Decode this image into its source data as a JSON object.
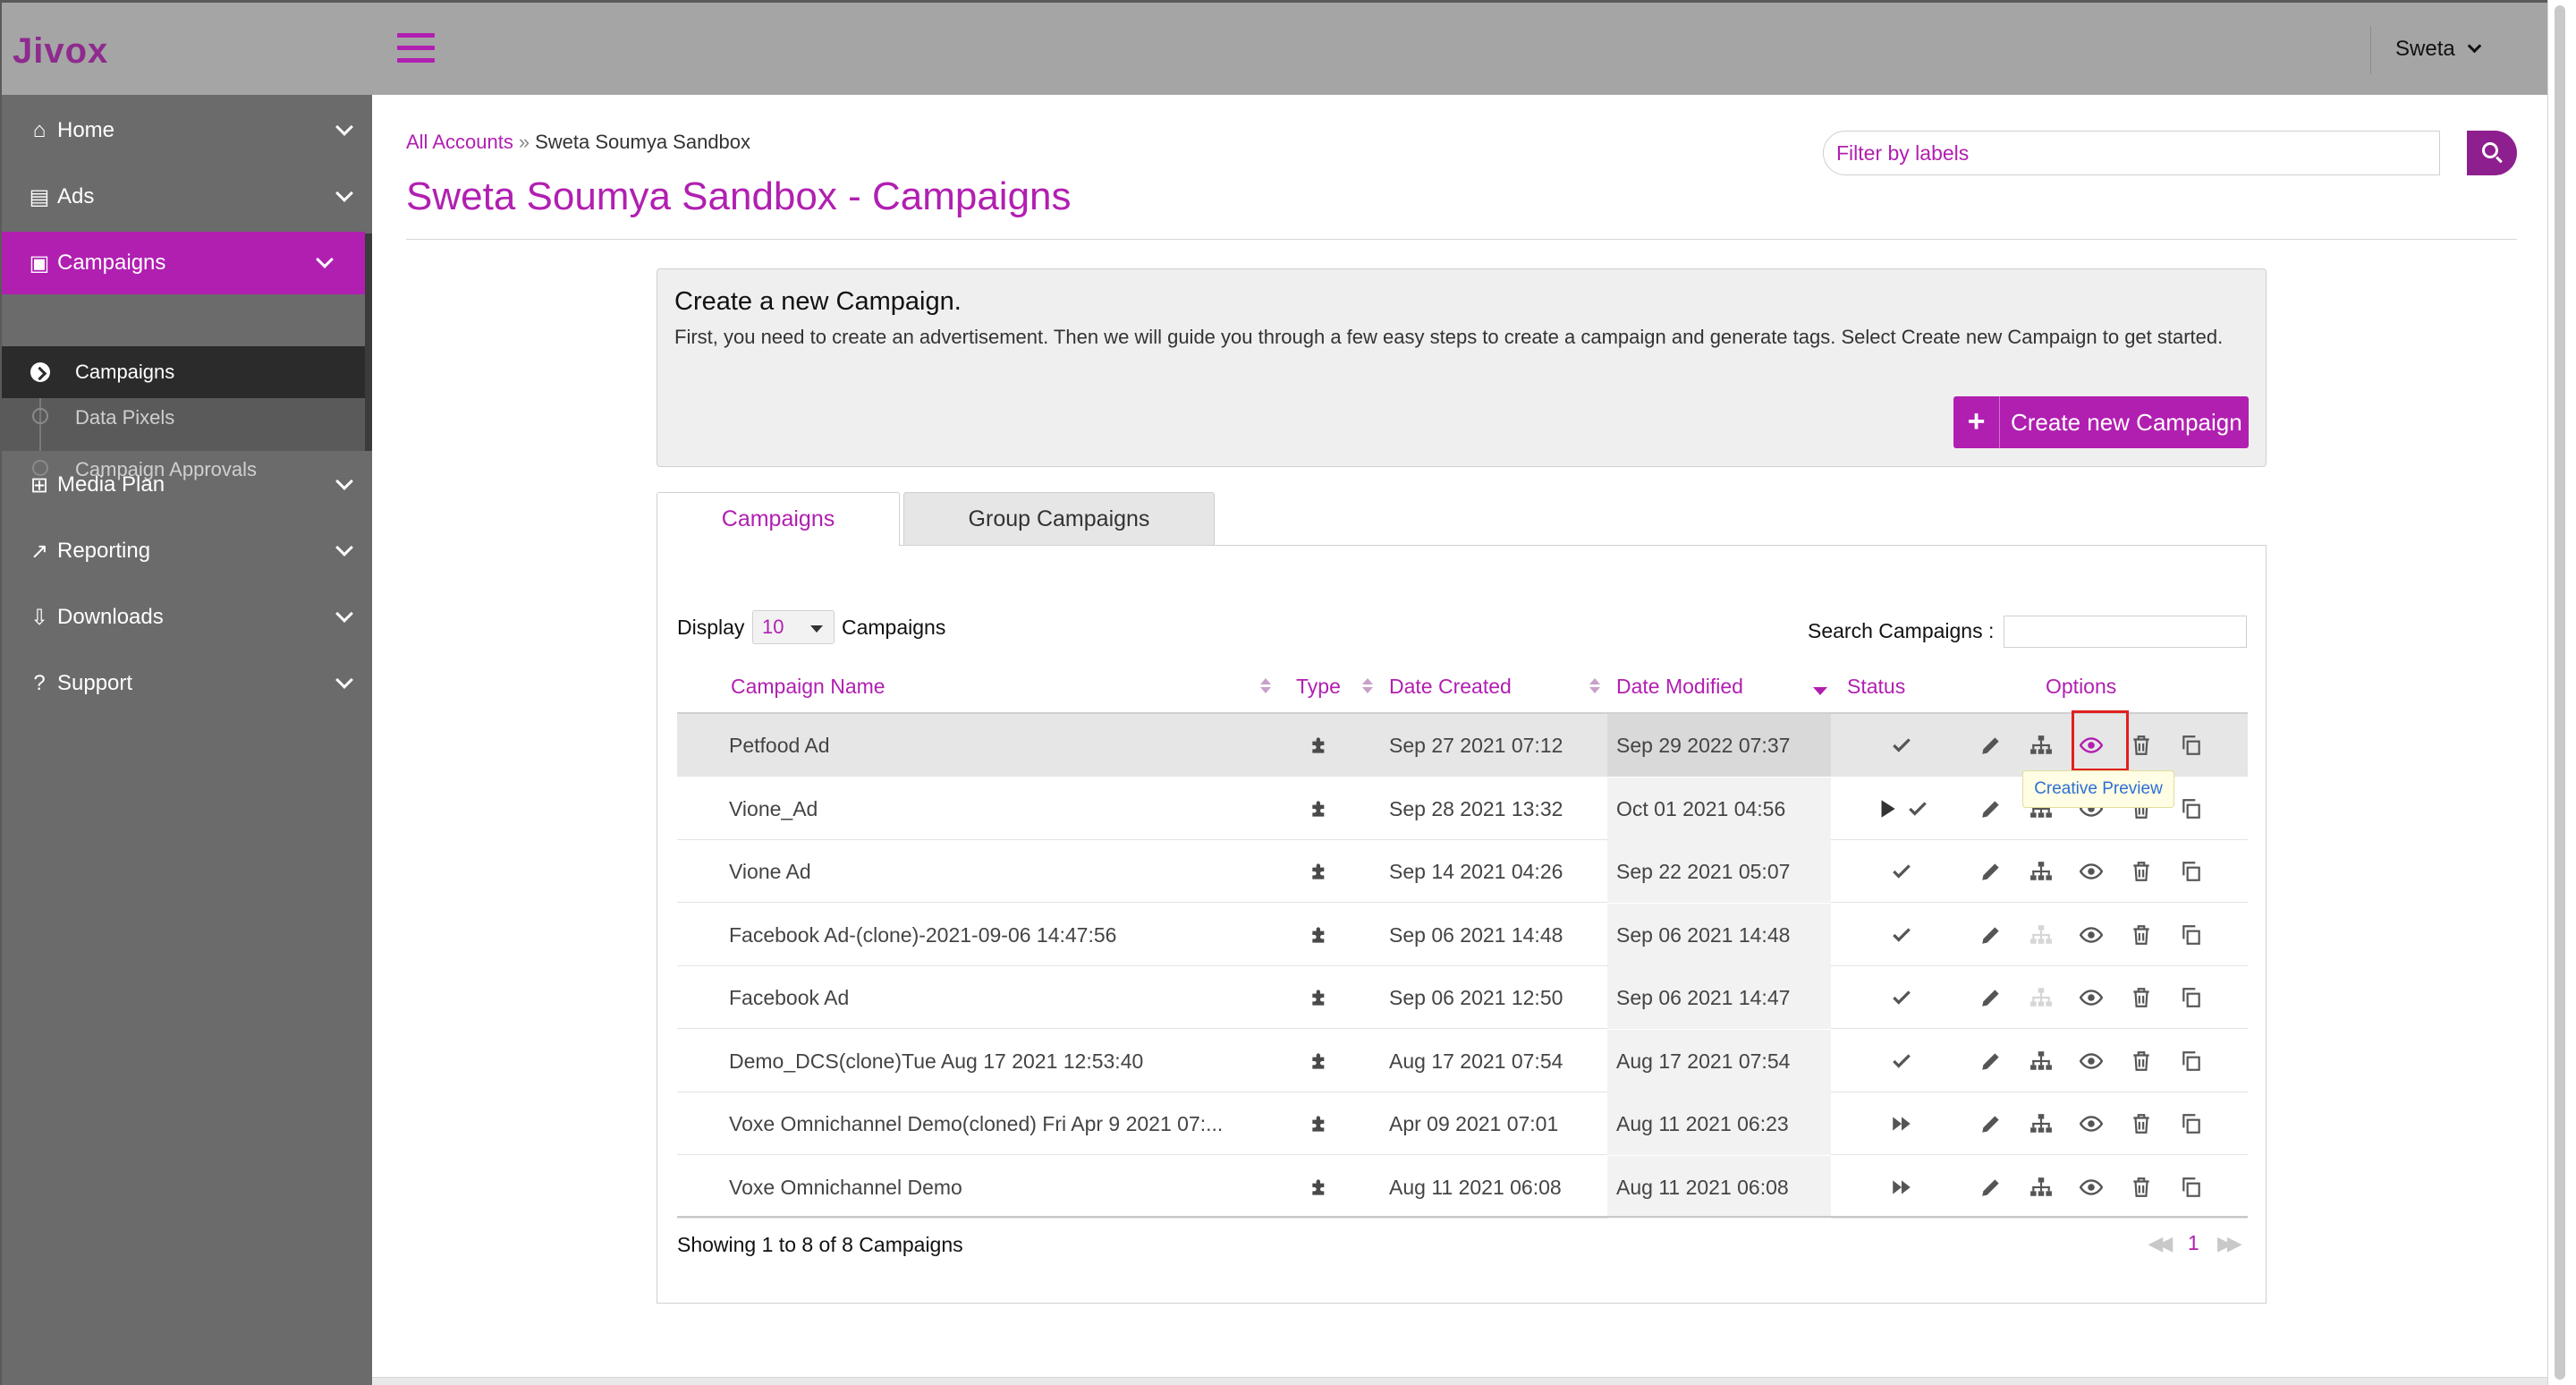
{
  "brand": {
    "logo": "Jivox",
    "accent": "#b11fb1"
  },
  "sidebar": {
    "items": [
      {
        "label": "Home",
        "icon": "home-icon"
      },
      {
        "label": "Ads",
        "icon": "ad-card-icon"
      },
      {
        "label": "Campaigns",
        "icon": "campaign-card-icon"
      },
      {
        "label": "Media Plan",
        "icon": "sitemap-icon"
      },
      {
        "label": "Reporting",
        "icon": "line-chart-icon"
      },
      {
        "label": "Downloads",
        "icon": "download-tray-icon"
      },
      {
        "label": "Support",
        "icon": "question-circle-icon"
      }
    ],
    "submenu": [
      "Campaigns",
      "Data Pixels",
      "Campaign Approvals"
    ]
  },
  "header": {
    "user": "Sweta"
  },
  "breadcrumb": {
    "root": "All Accounts",
    "separator": "»",
    "current": "Sweta Soumya Sandbox"
  },
  "page": {
    "title": "Sweta Soumya Sandbox - Campaigns"
  },
  "filter": {
    "placeholder": "Filter by labels"
  },
  "create": {
    "title": "Create a new Campaign.",
    "description": "First, you need to create an advertisement. Then we will guide you through a few easy steps to create a campaign and generate tags. Select Create new Campaign to get started.",
    "button": "Create new Campaign"
  },
  "tabs": [
    "Campaigns",
    "Group Campaigns"
  ],
  "list": {
    "display_label": "Display",
    "display_value": "10",
    "display_suffix": "Campaigns",
    "search_label": "Search Campaigns :",
    "search_value": ""
  },
  "table": {
    "columns": [
      "Campaign Name",
      "Type",
      "Date Created",
      "Date Modified",
      "Status",
      "Options"
    ],
    "rows": [
      {
        "name": "Petfood Ad",
        "created": "Sep 27 2021 07:12",
        "modified": "Sep 29 2022 07:37",
        "status": [
          "check"
        ],
        "hierarchy_enabled": true,
        "selected": true
      },
      {
        "name": "Vione_Ad",
        "created": "Sep 28 2021 13:32",
        "modified": "Oct 01 2021 04:56",
        "status": [
          "play",
          "check"
        ],
        "hierarchy_enabled": true,
        "selected": false
      },
      {
        "name": "Vione Ad",
        "created": "Sep 14 2021 04:26",
        "modified": "Sep 22 2021 05:07",
        "status": [
          "check"
        ],
        "hierarchy_enabled": true,
        "selected": false
      },
      {
        "name": "Facebook Ad-(clone)-2021-09-06 14:47:56",
        "created": "Sep 06 2021 14:48",
        "modified": "Sep 06 2021 14:48",
        "status": [
          "check"
        ],
        "hierarchy_enabled": false,
        "selected": false
      },
      {
        "name": "Facebook Ad",
        "created": "Sep 06 2021 12:50",
        "modified": "Sep 06 2021 14:47",
        "status": [
          "check"
        ],
        "hierarchy_enabled": false,
        "selected": false
      },
      {
        "name": "Demo_DCS(clone)Tue Aug 17 2021 12:53:40",
        "created": "Aug 17 2021 07:54",
        "modified": "Aug 17 2021 07:54",
        "status": [
          "check"
        ],
        "hierarchy_enabled": true,
        "selected": false
      },
      {
        "name": "Voxe Omnichannel Demo(cloned) Fri Apr 9 2021 07:...",
        "created": "Apr 09 2021 07:01",
        "modified": "Aug 11 2021 06:23",
        "status": [
          "fast-forward"
        ],
        "hierarchy_enabled": true,
        "selected": false
      },
      {
        "name": "Voxe Omnichannel Demo",
        "created": "Aug 11 2021 06:08",
        "modified": "Aug 11 2021 06:08",
        "status": [
          "fast-forward"
        ],
        "hierarchy_enabled": true,
        "selected": false
      }
    ]
  },
  "footer": {
    "showing": "Showing 1 to 8 of 8 Campaigns",
    "page": "1"
  },
  "tooltip": {
    "text": "Creative Preview"
  }
}
